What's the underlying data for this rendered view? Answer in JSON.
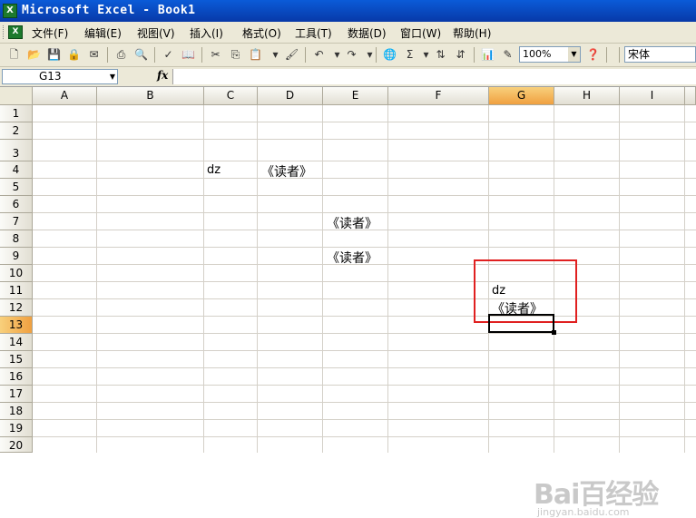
{
  "window": {
    "title": "Microsoft Excel - Book1"
  },
  "menu": [
    "文件(F)",
    "编辑(E)",
    "视图(V)",
    "插入(I)",
    "格式(O)",
    "工具(T)",
    "数据(D)",
    "窗口(W)",
    "帮助(H)"
  ],
  "toolbar": {
    "zoom": "100%",
    "font": "宋体",
    "icons": [
      "new-icon",
      "open-icon",
      "save-icon",
      "permission-icon",
      "email-icon",
      "print-icon",
      "print-preview-icon",
      "spelling-icon",
      "research-icon",
      "cut-icon",
      "copy-icon",
      "paste-icon",
      "format-painter-icon",
      "undo-icon",
      "redo-icon",
      "hyperlink-icon",
      "autosum-icon",
      "sort-ascending-icon",
      "sort-descending-icon",
      "chart-wizard-icon",
      "drawing-icon",
      "help-icon"
    ]
  },
  "formula_bar": {
    "name_box": "G13",
    "fx_label": "fx",
    "formula": ""
  },
  "sheet": {
    "columns": [
      "A",
      "B",
      "C",
      "D",
      "E",
      "F",
      "G",
      "H",
      "I"
    ],
    "rows": [
      "1",
      "2",
      "3",
      "4",
      "5",
      "6",
      "7",
      "8",
      "9",
      "10",
      "11",
      "12",
      "13",
      "14",
      "15",
      "16",
      "17",
      "18",
      "19",
      "20"
    ],
    "selected_column": "G",
    "selected_row": "13",
    "cells": {
      "C4": "dz",
      "D4": "《读者》",
      "E7": "《读者》",
      "E9": "《读者》",
      "G11": "dz",
      "G12": "《读者》"
    }
  },
  "watermark": {
    "main": "Bai百经验",
    "sub": "jingyan.baidu.com"
  },
  "colors": {
    "title_bar": "#0a5bd8",
    "selected_header": "#f0a040",
    "highlight_box": "#e02020"
  }
}
